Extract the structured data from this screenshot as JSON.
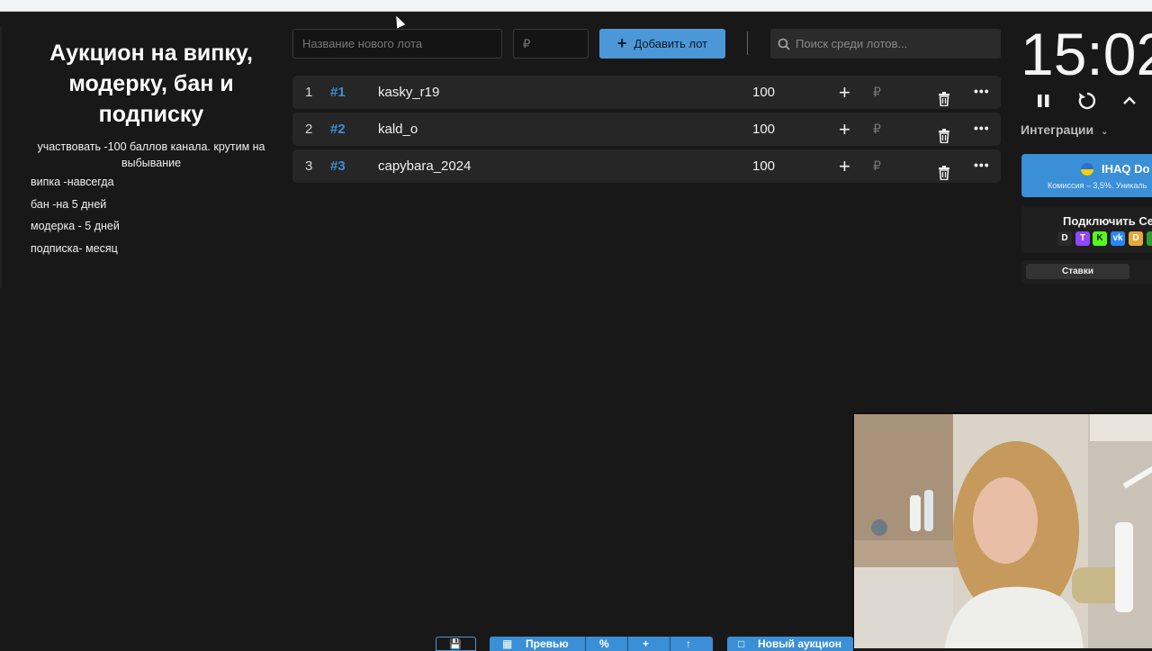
{
  "description": {
    "title": "Аукцион на випку, модерку, бан и подписку",
    "subtitle": "участвовать -100 баллов канала. крутим на выбывание",
    "lines": [
      "випка -навсегда",
      "бан -на 5 дней",
      "модерка - 5 дней",
      "подписка- месяц"
    ]
  },
  "toolbar": {
    "lot_name_placeholder": "Название нового лота",
    "amount_placeholder": "₽",
    "add_label": "Добавить лот",
    "search_placeholder": "Поиск среди лотов..."
  },
  "lots": [
    {
      "index": "1",
      "id": "#1",
      "name": "kasky_r19",
      "amount": "100"
    },
    {
      "index": "2",
      "id": "#2",
      "name": "kald_o",
      "amount": "100"
    },
    {
      "index": "3",
      "id": "#3",
      "name": "capybara_2024",
      "amount": "100"
    }
  ],
  "currency_symbol": "₽",
  "timer": "15:02",
  "integrations_label": "Интеграции",
  "donate": {
    "title": "IHAQ Do",
    "commission": "Комиссия – 3,5%. Уникаль"
  },
  "connect_label": "Подключить Се",
  "stakes_label": "Ставки",
  "bottom": {
    "preview_label": "Превью",
    "new_auction_label": "Новый аукцион"
  },
  "colors": {
    "accent": "#4b97d7",
    "background": "#181818",
    "row": "#262626"
  }
}
